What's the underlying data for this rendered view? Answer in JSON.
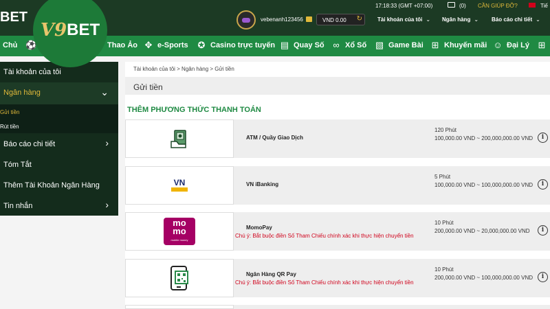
{
  "header": {
    "brand_fragment": "BET",
    "logo": {
      "prefix": "V9",
      "suffix": "BET"
    },
    "username": "vebenanh123456",
    "balance": "VND 0.00",
    "clock": "17:18:33 (GMT +07:00)",
    "mail_count": "(0)",
    "help_label": "CẦN GIÚP ĐỠ?",
    "lang_label": "Tiế",
    "menus": [
      {
        "label": "Tài khoản của tôi"
      },
      {
        "label": "Ngân hàng"
      },
      {
        "label": "Báo cáo chi tiết"
      }
    ]
  },
  "nav": {
    "items": [
      {
        "label": "Chủ",
        "icon": ""
      },
      {
        "label": "",
        "icon": "soccer-ball-icon"
      },
      {
        "label": "Thao Ảo",
        "icon": ""
      },
      {
        "label": "e-Sports",
        "icon": "gamepad-icon"
      },
      {
        "label": "Casino trực tuyến",
        "icon": "casino-chip-icon"
      },
      {
        "label": "Quay Số",
        "icon": "lottery-ticket-icon"
      },
      {
        "label": "Xổ Số",
        "icon": "lottery-balls-icon"
      },
      {
        "label": "Game Bài",
        "icon": "cards-icon"
      },
      {
        "label": "Khuyến mãi",
        "icon": "gift-icon"
      },
      {
        "label": "Đại Lý",
        "icon": "agent-icon"
      }
    ]
  },
  "sidebar": {
    "items": [
      {
        "label": "Tài khoản của tôi"
      },
      {
        "label": "Ngân hàng"
      },
      {
        "label": "Báo cáo chi tiết"
      },
      {
        "label": "Tóm Tắt"
      },
      {
        "label": "Thêm Tài Khoản Ngân Hàng"
      },
      {
        "label": "Tin nhắn"
      }
    ],
    "sub_items": [
      {
        "label": "Gửi tiền"
      },
      {
        "label": "Rút tiền"
      }
    ]
  },
  "main": {
    "breadcrumb": "Tài khoản của tôi > Ngân hàng > Gửi tiền",
    "page_title": "Gửi tiền",
    "section_title": "THÊM PHƯƠNG THỨC THANH TOÁN",
    "methods": [
      {
        "name": "ATM / Quầy Giao Dịch",
        "time": "120 Phút",
        "range": "100,000.00 VND ~ 200,000,000.00 VND",
        "note": ""
      },
      {
        "name": "VN iBanking",
        "time": "5 Phút",
        "range": "100,000.00 VND ~ 100,000,000.00 VND",
        "note": ""
      },
      {
        "name": "MomoPay",
        "time": "10 Phút",
        "range": "200,000.00 VND ~ 20,000,000.00 VND",
        "note": "Chú ý: Bắt buộc điền Số Tham Chiếu chính xác khi thực hiện chuyển tiền"
      },
      {
        "name": "Ngân Hàng QR Pay",
        "time": "10 Phút",
        "range": "200,000.00 VND ~ 100,000,000.00 VND",
        "note": "Chú ý: Bắt buộc điền Số Tham Chiếu chính xác khi thực hiện chuyển tiền"
      }
    ],
    "logos": {
      "vn_ibanking": "VN",
      "momo_top": "mo",
      "momo_bottom": "mo",
      "momo_small": "mobile money"
    },
    "info_glyph": "i"
  },
  "colors": {
    "header_bg": "#1c3a24",
    "nav_bg": "#1f8a43",
    "logo_circle": "#1d7a38",
    "accent_gold": "#e0b93a",
    "sidebar_bg": "#142c1c",
    "note_red": "#d0021b",
    "section_green": "#1f8a43"
  }
}
